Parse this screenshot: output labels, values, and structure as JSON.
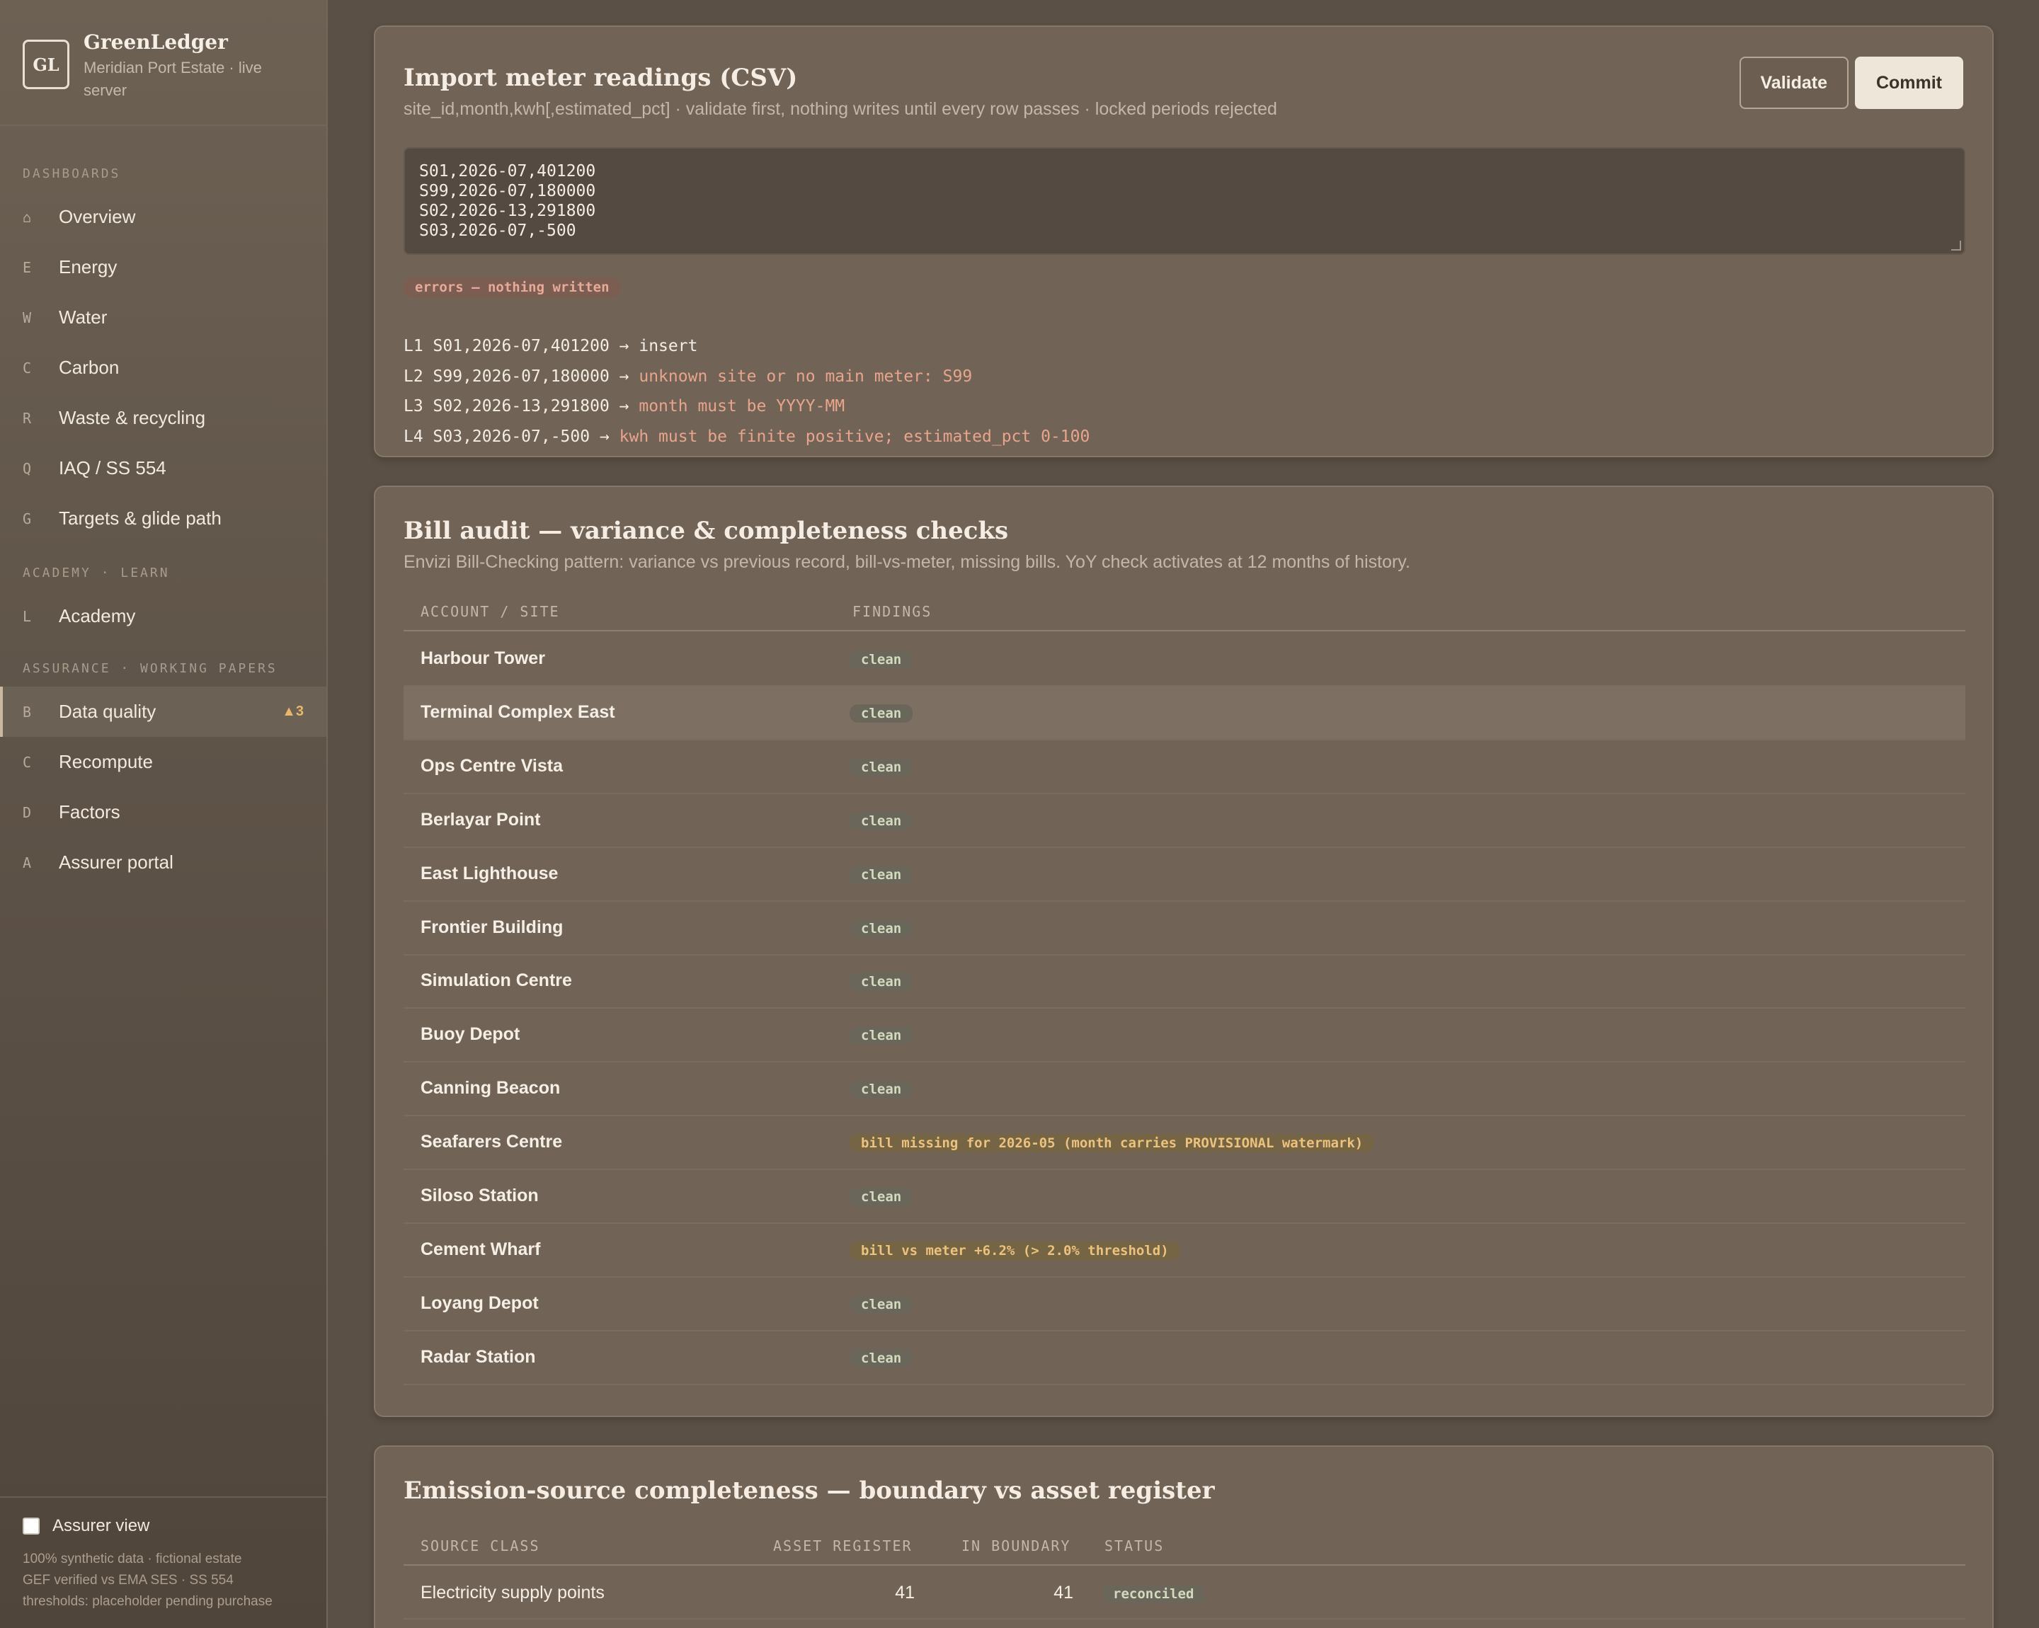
{
  "brand": {
    "logo": "GL",
    "name": "GreenLedger",
    "subtitle": "Meridian Port Estate · live server"
  },
  "nav": {
    "sections": [
      {
        "title": "DASHBOARDS",
        "items": [
          {
            "key": "⌂",
            "label": "Overview"
          },
          {
            "key": "E",
            "label": "Energy"
          },
          {
            "key": "W",
            "label": "Water"
          },
          {
            "key": "C",
            "label": "Carbon"
          },
          {
            "key": "R",
            "label": "Waste & recycling"
          },
          {
            "key": "Q",
            "label": "IAQ / SS 554"
          },
          {
            "key": "G",
            "label": "Targets & glide path"
          }
        ]
      },
      {
        "title": "ACADEMY · LEARN",
        "items": [
          {
            "key": "L",
            "label": "Academy"
          }
        ]
      },
      {
        "title": "ASSURANCE · WORKING PAPERS",
        "items": [
          {
            "key": "B",
            "label": "Data quality",
            "badge": "▲3",
            "active": true
          },
          {
            "key": "C",
            "label": "Recompute"
          },
          {
            "key": "D",
            "label": "Factors"
          },
          {
            "key": "A",
            "label": "Assurer portal"
          }
        ]
      }
    ]
  },
  "footer": {
    "assurer_label": "Assurer view",
    "assurer_checked": false,
    "lines": [
      "100% synthetic data · fictional estate",
      "GEF verified vs EMA SES · SS 554",
      "thresholds: placeholder pending purchase"
    ]
  },
  "import": {
    "title": "Import meter readings (CSV)",
    "subtitle": "site_id,month,kwh[,estimated_pct] · validate first, nothing writes until every row passes · locked periods rejected",
    "validate_label": "Validate",
    "commit_label": "Commit",
    "csv_lines": [
      "S01,2026-07,401200",
      "S99,2026-07,180000",
      "S02,2026-13,291800",
      "S03,2026-07,-500"
    ],
    "status_pill": "errors — nothing written",
    "results": [
      {
        "prefix": "L1 S01,2026-07,401200 →",
        "message": "insert",
        "error": false
      },
      {
        "prefix": "L2 S99,2026-07,180000 →",
        "message": "unknown site or no main meter: S99",
        "error": true
      },
      {
        "prefix": "L3 S02,2026-13,291800 →",
        "message": "month must be YYYY-MM",
        "error": true
      },
      {
        "prefix": "L4 S03,2026-07,-500 →",
        "message": "kwh must be finite positive; estimated_pct 0-100",
        "error": true
      }
    ]
  },
  "audit": {
    "title": "Bill audit — variance & completeness checks",
    "subtitle": "Envizi Bill-Checking pattern: variance vs previous record, bill-vs-meter, missing bills. YoY check activates at 12 months of history.",
    "col_site": "ACCOUNT / SITE",
    "col_findings": "FINDINGS",
    "rows": [
      {
        "site": "Harbour Tower",
        "finding": "clean",
        "status": "clean"
      },
      {
        "site": "Terminal Complex East",
        "finding": "clean",
        "status": "clean",
        "highlight": true
      },
      {
        "site": "Ops Centre Vista",
        "finding": "clean",
        "status": "clean"
      },
      {
        "site": "Berlayar Point",
        "finding": "clean",
        "status": "clean"
      },
      {
        "site": "East Lighthouse",
        "finding": "clean",
        "status": "clean"
      },
      {
        "site": "Frontier Building",
        "finding": "clean",
        "status": "clean"
      },
      {
        "site": "Simulation Centre",
        "finding": "clean",
        "status": "clean"
      },
      {
        "site": "Buoy Depot",
        "finding": "clean",
        "status": "clean"
      },
      {
        "site": "Canning Beacon",
        "finding": "clean",
        "status": "clean"
      },
      {
        "site": "Seafarers Centre",
        "finding": "bill missing for 2026-05 (month carries PROVISIONAL watermark)",
        "status": "warn"
      },
      {
        "site": "Siloso Station",
        "finding": "clean",
        "status": "clean"
      },
      {
        "site": "Cement Wharf",
        "finding": "bill vs meter +6.2% (> 2.0% threshold)",
        "status": "warn"
      },
      {
        "site": "Loyang Depot",
        "finding": "clean",
        "status": "clean"
      },
      {
        "site": "Radar Station",
        "finding": "clean",
        "status": "clean"
      }
    ]
  },
  "completeness": {
    "title": "Emission-source completeness — boundary vs asset register",
    "col_class": "SOURCE CLASS",
    "col_register": "ASSET REGISTER",
    "col_boundary": "IN BOUNDARY",
    "col_status": "STATUS",
    "rows": [
      {
        "source_class": "Electricity supply points",
        "asset_register": "41",
        "in_boundary": "41",
        "status": "reconciled"
      }
    ]
  }
}
